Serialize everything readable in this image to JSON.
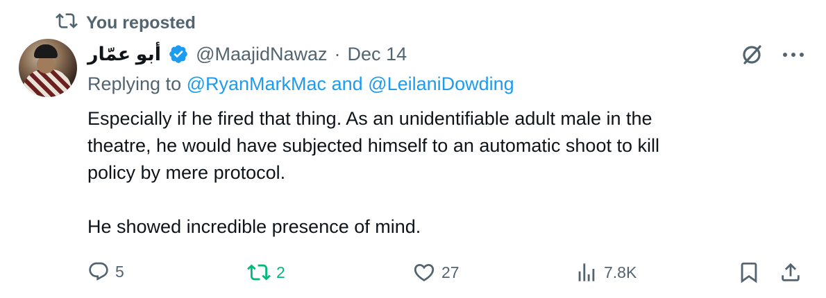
{
  "repost": {
    "label": "You reposted"
  },
  "tweet": {
    "author_name": "أبو عمّار",
    "handle": "@MaajidNawaz",
    "separator": "·",
    "date": "Dec 14",
    "replying_prefix": "Replying to",
    "mention_1": "@RyanMarkMac",
    "mention_joiner": "and",
    "mention_2": "@LeilaniDowding",
    "body": [
      "Especially if he fired that thing. As an unidentifiable adult male in the",
      "theatre, he would have subjected himself to an automatic shoot to kill",
      "policy by mere protocol.",
      "",
      "He showed incredible presence of mind."
    ]
  },
  "actions": {
    "replies": "5",
    "reposts": "2",
    "likes": "27",
    "views": "7.8K"
  },
  "icons": {
    "repost": "repost-icon",
    "verified": "verified-badge-icon",
    "grok": "grok-icon",
    "more": "more-icon",
    "reply": "reply-icon",
    "like": "heart-icon",
    "views": "analytics-icon",
    "bookmark": "bookmark-icon",
    "share": "share-icon"
  },
  "colors": {
    "text": "#0f1419",
    "secondary": "#536471",
    "link": "#1d9bf0",
    "repost_active": "#00ba7c"
  }
}
